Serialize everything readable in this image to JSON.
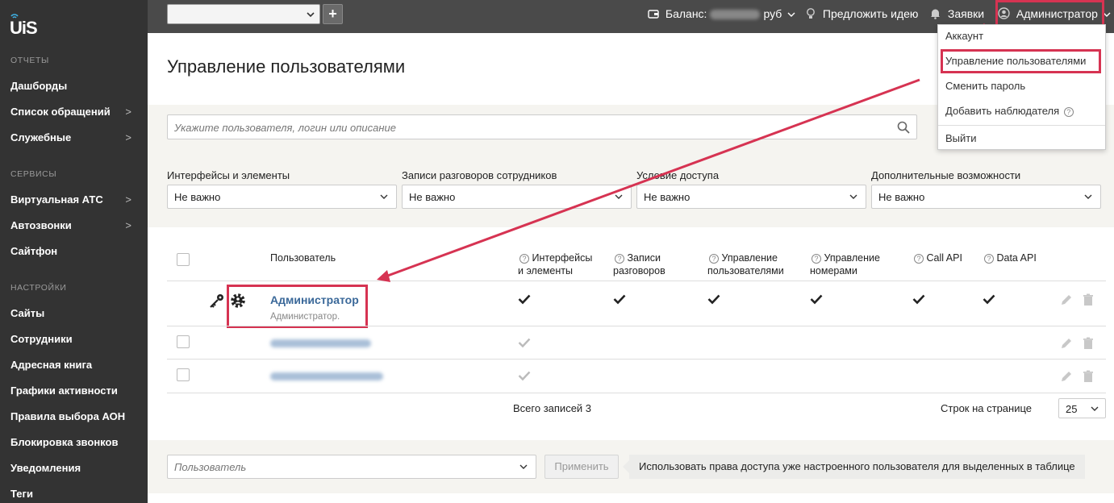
{
  "colors": {
    "sidebar_bg": "#333333",
    "topbar_bg": "#4a4a4a",
    "highlight": "#d63352",
    "link": "#3a6899"
  },
  "logo": {
    "text": "UiS"
  },
  "sidebar": {
    "sections": [
      {
        "title": "ОТЧЕТЫ",
        "items": [
          {
            "label": "Дашборды",
            "has_arrow": false
          },
          {
            "label": "Список обращений",
            "has_arrow": true
          },
          {
            "label": "Служебные",
            "has_arrow": true
          }
        ]
      },
      {
        "title": "СЕРВИСЫ",
        "items": [
          {
            "label": "Виртуальная АТС",
            "has_arrow": true
          },
          {
            "label": "Автозвонки",
            "has_arrow": true
          },
          {
            "label": "Сайтфон",
            "has_arrow": false
          }
        ]
      },
      {
        "title": "НАСТРОЙКИ",
        "items": [
          {
            "label": "Сайты",
            "has_arrow": false
          },
          {
            "label": "Сотрудники",
            "has_arrow": false
          },
          {
            "label": "Адресная книга",
            "has_arrow": false
          },
          {
            "label": "Графики активности",
            "has_arrow": false
          },
          {
            "label": "Правила выбора АОН",
            "has_arrow": false
          },
          {
            "label": "Блокировка звонков",
            "has_arrow": false
          },
          {
            "label": "Уведомления",
            "has_arrow": false
          },
          {
            "label": "Теги",
            "has_arrow": false
          }
        ]
      }
    ]
  },
  "topbar": {
    "balance_label": "Баланс:",
    "balance_currency": "руб",
    "suggest": "Предложить идею",
    "requests": "Заявки",
    "user": "Администратор"
  },
  "user_menu": {
    "items": [
      "Аккаунт",
      "Управление пользователями",
      "Сменить пароль",
      "Добавить наблюдателя",
      "Выйти"
    ],
    "highlighted": "Управление пользователями"
  },
  "page": {
    "title": "Управление пользователями"
  },
  "search": {
    "placeholder": "Укажите пользователя, логин или описание"
  },
  "filters": [
    {
      "label": "Интерфейсы и элементы",
      "value": "Не важно"
    },
    {
      "label": "Записи разговоров сотрудников",
      "value": "Не важно"
    },
    {
      "label": "Условие доступа",
      "value": "Не важно"
    },
    {
      "label": "Дополнительные возможности",
      "value": "Не важно"
    }
  ],
  "table": {
    "columns": {
      "user": "Пользователь",
      "interfaces": [
        "Интерфейсы",
        "и элементы"
      ],
      "records": [
        "Записи",
        "разговоров"
      ],
      "user_mgmt": [
        "Управление",
        "пользователями"
      ],
      "numbers_mgmt": [
        "Управление",
        "номерами"
      ],
      "call_api": "Call API",
      "data_api": "Data API"
    },
    "admin_row": {
      "name": "Администратор",
      "description": "Администратор."
    },
    "total": "Всего записей 3",
    "rows_per_page_label": "Строк на странице",
    "rows_per_page": "25"
  },
  "bulk": {
    "user_placeholder": "Пользователь",
    "apply": "Применить",
    "hint": "Использовать права доступа уже настроенного пользователя для выделенных в таблице"
  }
}
